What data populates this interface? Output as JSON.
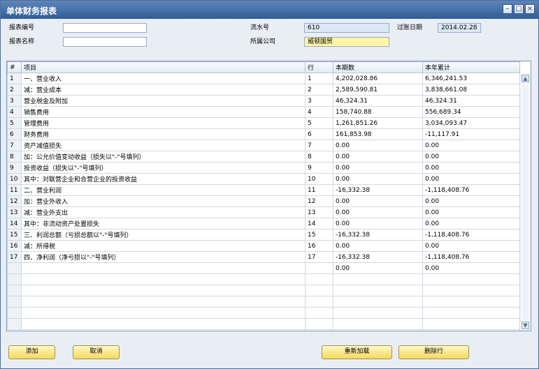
{
  "window": {
    "title": "单体财务报表"
  },
  "form": {
    "report_no_label": "报表编号",
    "report_no_value": "",
    "report_name_label": "报表名称",
    "report_name_value": "",
    "serial_label": "流水号",
    "serial_value": "610",
    "posting_date_label": "过账日期",
    "posting_date_value": "2014.02.28",
    "company_label": "所属公司",
    "company_value": "威顿国贸"
  },
  "table": {
    "headers": [
      "#",
      "项目",
      "行",
      "本期数",
      "本年累计"
    ],
    "rows": [
      {
        "num": "1",
        "item": "一、营业收入",
        "line": "1",
        "current": "4,202,028.86",
        "ytd": "6,346,241.53"
      },
      {
        "num": "2",
        "item": "减：营业成本",
        "line": "2",
        "current": "2,589,590.81",
        "ytd": "3,838,661.08"
      },
      {
        "num": "3",
        "item": "营业税金及附加",
        "line": "3",
        "current": "46,324.31",
        "ytd": "46,324.31"
      },
      {
        "num": "4",
        "item": "销售费用",
        "line": "4",
        "current": "158,740.88",
        "ytd": "556,689.34"
      },
      {
        "num": "5",
        "item": "管理费用",
        "line": "5",
        "current": "1,261,851.26",
        "ytd": "3,034,093.47"
      },
      {
        "num": "6",
        "item": "财务费用",
        "line": "6",
        "current": "161,853.98",
        "ytd": "-11,117.91"
      },
      {
        "num": "7",
        "item": "资产减值损失",
        "line": "7",
        "current": "0.00",
        "ytd": "0.00"
      },
      {
        "num": "8",
        "item": "加：公允价值变动收益（损失以\"-\"号填列）",
        "line": "8",
        "current": "0.00",
        "ytd": "0.00"
      },
      {
        "num": "9",
        "item": "投资收益（损失以\"-\"号填列）",
        "line": "9",
        "current": "0.00",
        "ytd": "0.00"
      },
      {
        "num": "10",
        "item": "其中：对联营企业和合营企业的投资收益",
        "line": "10",
        "current": "0.00",
        "ytd": "0.00"
      },
      {
        "num": "11",
        "item": "二、营业利润",
        "line": "11",
        "current": "-16,332.38",
        "ytd": "-1,118,408.76"
      },
      {
        "num": "12",
        "item": "加：营业外收入",
        "line": "12",
        "current": "0.00",
        "ytd": "0.00"
      },
      {
        "num": "13",
        "item": "减：营业外支出",
        "line": "13",
        "current": "0.00",
        "ytd": "0.00"
      },
      {
        "num": "14",
        "item": "其中：非流动资产处置损失",
        "line": "14",
        "current": "0.00",
        "ytd": "0.00"
      },
      {
        "num": "15",
        "item": "三、利润总额（亏损总额以\"-\"号填列）",
        "line": "15",
        "current": "-16,332.38",
        "ytd": "-1,118,408.76"
      },
      {
        "num": "16",
        "item": "减：所得税",
        "line": "16",
        "current": "0.00",
        "ytd": "0.00"
      },
      {
        "num": "17",
        "item": "四、净利润（净亏损以\"-\"号填列）",
        "line": "17",
        "current": "-16,332.38",
        "ytd": "-1,118,408.76"
      },
      {
        "num": "",
        "item": "",
        "line": "",
        "current": "0.00",
        "ytd": "0.00"
      }
    ]
  },
  "buttons": {
    "add": "添加",
    "cancel": "取消",
    "reload": "重新加载",
    "delete_row": "删除行"
  },
  "colors": {
    "title_bar": "#3e6aa6",
    "button": "#f6d95c",
    "company_field": "#fff8a8",
    "serial_field": "#dce8f5"
  }
}
